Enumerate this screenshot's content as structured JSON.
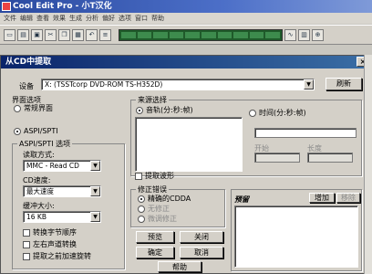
{
  "app": {
    "title": "Cool Edit Pro  - 小T汉化",
    "menu": [
      "文件",
      "编辑",
      "查看",
      "效果",
      "生成",
      "分析",
      "偏好",
      "选项",
      "窗口",
      "帮助"
    ]
  },
  "dialog": {
    "title": "从CD中提取",
    "close_glyph": "×",
    "device_label": "设备",
    "device_value": "X: (TSSTcorp DVD-ROM TS-H352D)",
    "refresh_label": "刷新",
    "interface_group": "界面选项",
    "interface_options": [
      {
        "label": "常规界面",
        "selected": false
      },
      {
        "label": "ASPI/SPTI",
        "selected": true
      }
    ],
    "aspi_group": "ASPI/SPTI 选项",
    "read_mode_label": "读取方式:",
    "read_mode_value": "MMC - Read CD",
    "cd_speed_label": "CD速度:",
    "cd_speed_value": "最大速度",
    "buffer_label": "缓冲大小:",
    "buffer_value": "16 KB",
    "checkboxes": [
      "转换字节顺序",
      "左右声道转换",
      "提取之前加速旋转"
    ],
    "source_group": "来源选择",
    "track_radio": "音轨(分:秒:帧)",
    "time_radio": "时间(分:秒:帧)",
    "start_label": "开始",
    "length_label": "长度",
    "extract_waveform": "提取波形",
    "correction_group": "修正错误",
    "correction_options": [
      {
        "label": "精确的CDDA",
        "selected": true,
        "enabled": true
      },
      {
        "label": "无修正",
        "selected": false,
        "enabled": false
      },
      {
        "label": "微调修正",
        "selected": false,
        "enabled": false
      }
    ],
    "preview_button": "预览",
    "close_button": "关闭",
    "ok_button": "确定",
    "cancel_button": "取消",
    "help_button": "帮助",
    "queue_label": "预留",
    "add_button": "增加",
    "remove_button": "移除"
  }
}
